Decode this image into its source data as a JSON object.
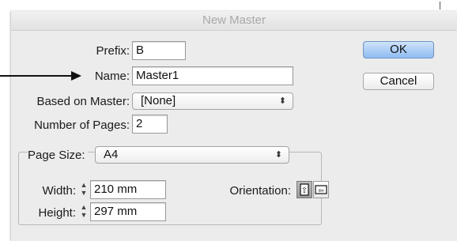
{
  "window": {
    "title": "New Master"
  },
  "form": {
    "prefix_label": "Prefix:",
    "prefix_value": "B",
    "name_label": "Name:",
    "name_value": "Master1",
    "based_on_label": "Based on Master:",
    "based_on_value": "[None]",
    "num_pages_label": "Number of Pages:",
    "num_pages_value": "2"
  },
  "page_size": {
    "label": "Page Size:",
    "value": "A4",
    "width_label": "Width:",
    "width_value": "210 mm",
    "height_label": "Height:",
    "height_value": "297 mm",
    "orientation_label": "Orientation:",
    "orientation_selected": "portrait"
  },
  "buttons": {
    "ok_label": "OK",
    "cancel_label": "Cancel"
  },
  "icons": {
    "select_arrows": "updown-arrows-icon",
    "stepper": "stepper-icon",
    "portrait": "portrait-orientation-icon",
    "landscape": "landscape-orientation-icon",
    "callout": "callout-arrow"
  }
}
